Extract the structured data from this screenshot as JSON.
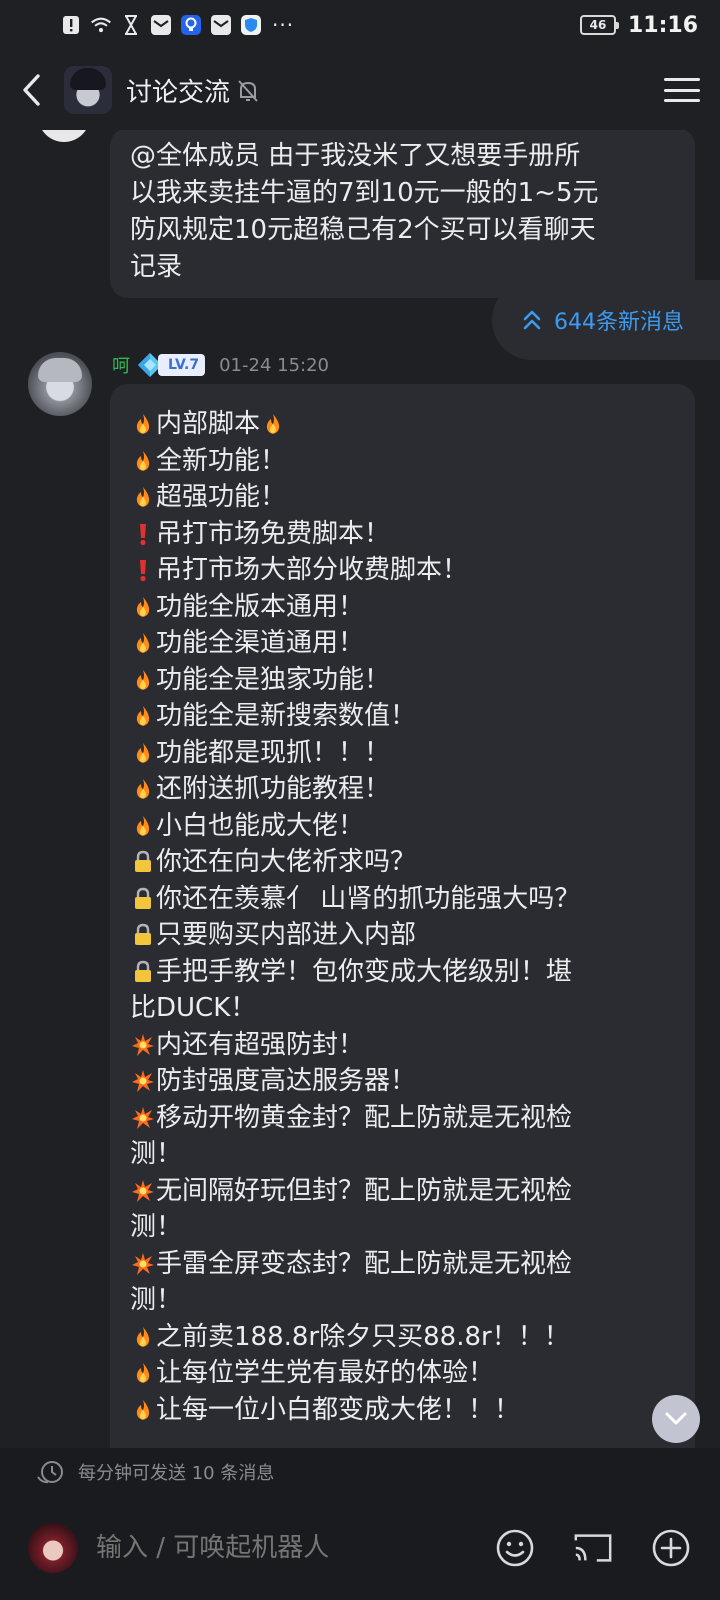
{
  "status_bar": {
    "battery": "46",
    "time": "11:16",
    "more_indicator": "···",
    "icons": [
      "notification-alert-icon",
      "wifi-icon",
      "hourglass-icon",
      "mail-app-icon",
      "lightbulb-app-icon",
      "mail-app-icon",
      "shield-app-icon"
    ]
  },
  "header": {
    "title": "讨论交流",
    "icons": [
      "back-icon",
      "mute-icon",
      "menu-icon"
    ]
  },
  "messages": {
    "first_bubble": {
      "lines": [
        "@全体成员 由于我没米了又想要手册所",
        "以我来卖挂牛逼的7到10元一般的1~5元",
        "防风规定10元超稳己有2个买可以看聊天",
        "记录"
      ]
    },
    "new_messages": "644条新消息",
    "second": {
      "sender": "呵",
      "level": "LV.7",
      "time": "01-24 15:20",
      "lines": [
        {
          "emoji": "fire",
          "text": "内部脚本",
          "trail": "fire"
        },
        {
          "emoji": "fire",
          "text": "全新功能！"
        },
        {
          "emoji": "fire",
          "text": "超强功能！"
        },
        {
          "emoji": "exclamation",
          "text": "吊打市场免费脚本！"
        },
        {
          "emoji": "exclamation",
          "text": "吊打市场大部分收费脚本！"
        },
        {
          "emoji": "fire",
          "text": "功能全版本通用！"
        },
        {
          "emoji": "fire",
          "text": "功能全渠道通用！"
        },
        {
          "emoji": "fire",
          "text": "功能全是独家功能！"
        },
        {
          "emoji": "fire",
          "text": "功能全是新搜索数值！"
        },
        {
          "emoji": "fire",
          "text": "功能都是现抓！！！"
        },
        {
          "emoji": "fire",
          "text": "还附送抓功能教程！"
        },
        {
          "emoji": "fire",
          "text": "小白也能成大佬！"
        },
        {
          "emoji": "lock",
          "text": "你还在向大佬祈求吗？"
        },
        {
          "emoji": "lock",
          "text": "你还在羡慕亻 山肾的抓功能强大吗？"
        },
        {
          "emoji": "lock",
          "text": "只要购买内部进入内部"
        },
        {
          "emoji": "lock",
          "text": "手把手教学！包你变成大佬级别！堪"
        },
        {
          "emoji": "",
          "text": "比DUCK！"
        },
        {
          "emoji": "boom",
          "text": "内还有超强防封！"
        },
        {
          "emoji": "boom",
          "text": "防封强度高达服务器！"
        },
        {
          "emoji": "boom",
          "text": "移动开物黄金封？配上防就是无视检"
        },
        {
          "emoji": "",
          "text": "测！"
        },
        {
          "emoji": "boom",
          "text": "无间隔好玩但封？配上防就是无视检"
        },
        {
          "emoji": "",
          "text": "测！"
        },
        {
          "emoji": "boom",
          "text": "手雷全屏变态封？配上防就是无视检"
        },
        {
          "emoji": "",
          "text": "测！"
        },
        {
          "emoji": "fire",
          "text": "之前卖188.8r除夕只买88.8r！！！"
        },
        {
          "emoji": "fire",
          "text": "让每位学生党有最好的体验！"
        },
        {
          "emoji": "fire",
          "text": "让每一位小白都变成大佬！！！"
        }
      ]
    }
  },
  "rate_limit": "每分钟可发送 10 条消息",
  "input": {
    "placeholder": "输入 / 可唤起机器人"
  },
  "colors": {
    "background": "#1f2024",
    "bubble": "#2b2c31",
    "accent_blue": "#3d9bf0",
    "sender_green": "#2dba4e"
  }
}
